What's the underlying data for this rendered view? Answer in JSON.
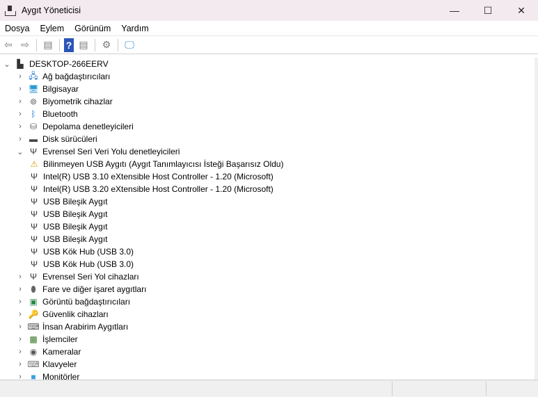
{
  "window": {
    "title": "Aygıt Yöneticisi",
    "minimize": "—",
    "maximize": "☐",
    "close": "✕"
  },
  "menu": [
    "Dosya",
    "Eylem",
    "Görünüm",
    "Yardım"
  ],
  "toolbar": [
    {
      "name": "back-icon",
      "glyph": "⇦"
    },
    {
      "name": "forward-icon",
      "glyph": "⇨"
    },
    {
      "name": "sep"
    },
    {
      "name": "show-hide-console-tree-icon",
      "glyph": "▤"
    },
    {
      "name": "sep"
    },
    {
      "name": "help-icon",
      "glyph": "?"
    },
    {
      "name": "action-pane-icon",
      "glyph": "▤"
    },
    {
      "name": "sep"
    },
    {
      "name": "update-driver-icon",
      "glyph": "⚙"
    },
    {
      "name": "sep"
    },
    {
      "name": "scan-hardware-icon",
      "glyph": "🖵"
    }
  ],
  "tree": {
    "root": "DESKTOP-266EERV",
    "items": [
      {
        "label": "Ağ bağdaştırıcıları",
        "icon": "network-icon",
        "glyph": "🖧",
        "color": "#2a7bd4",
        "level": 1,
        "expanded": false
      },
      {
        "label": "Bilgisayar",
        "icon": "computer-icon",
        "glyph": "🖥",
        "color": "#2a9ad4",
        "level": 1,
        "expanded": false
      },
      {
        "label": "Biyometrik cihazlar",
        "icon": "fingerprint-icon",
        "glyph": "⊚",
        "color": "#555",
        "level": 1,
        "expanded": false
      },
      {
        "label": "Bluetooth",
        "icon": "bluetooth-icon",
        "glyph": "ᛒ",
        "color": "#1a6fd8",
        "level": 1,
        "expanded": false
      },
      {
        "label": "Depolama denetleyicileri",
        "icon": "storage-controller-icon",
        "glyph": "⛁",
        "color": "#555",
        "level": 1,
        "expanded": false
      },
      {
        "label": "Disk sürücüleri",
        "icon": "disk-drive-icon",
        "glyph": "▬",
        "color": "#444",
        "level": 1,
        "expanded": false
      },
      {
        "label": "Evrensel Seri Veri Yolu denetleyicileri",
        "icon": "usb-icon",
        "glyph": "Ψ",
        "color": "#333",
        "level": 1,
        "expanded": true
      },
      {
        "label": "Bilinmeyen USB Aygıtı (Aygıt Tanımlayıcısı İsteği Başarısız Oldu)",
        "icon": "warning-icon",
        "glyph": "⚠",
        "color": "#d4a000",
        "level": 2
      },
      {
        "label": "Intel(R) USB 3.10 eXtensible Host Controller - 1.20 (Microsoft)",
        "icon": "usb-icon",
        "glyph": "Ψ",
        "color": "#333",
        "level": 2
      },
      {
        "label": "Intel(R) USB 3.20 eXtensible Host Controller - 1.20 (Microsoft)",
        "icon": "usb-icon",
        "glyph": "Ψ",
        "color": "#333",
        "level": 2
      },
      {
        "label": "USB Bileşik Aygıt",
        "icon": "usb-icon",
        "glyph": "Ψ",
        "color": "#333",
        "level": 2
      },
      {
        "label": "USB Bileşik Aygıt",
        "icon": "usb-icon",
        "glyph": "Ψ",
        "color": "#333",
        "level": 2
      },
      {
        "label": "USB Bileşik Aygıt",
        "icon": "usb-icon",
        "glyph": "Ψ",
        "color": "#333",
        "level": 2
      },
      {
        "label": "USB Bileşik Aygıt",
        "icon": "usb-icon",
        "glyph": "Ψ",
        "color": "#333",
        "level": 2
      },
      {
        "label": "USB Kök Hub (USB 3.0)",
        "icon": "usb-icon",
        "glyph": "Ψ",
        "color": "#333",
        "level": 2
      },
      {
        "label": "USB Kök Hub (USB 3.0)",
        "icon": "usb-icon",
        "glyph": "Ψ",
        "color": "#333",
        "level": 2
      },
      {
        "label": "Evrensel Seri Yol cihazları",
        "icon": "usb-icon",
        "glyph": "Ψ",
        "color": "#333",
        "level": 1,
        "expanded": false
      },
      {
        "label": "Fare ve diğer işaret aygıtları",
        "icon": "mouse-icon",
        "glyph": "⬮",
        "color": "#666",
        "level": 1,
        "expanded": false
      },
      {
        "label": "Görüntü bağdaştırıcıları",
        "icon": "display-adapter-icon",
        "glyph": "▣",
        "color": "#2a8a4a",
        "level": 1,
        "expanded": false
      },
      {
        "label": "Güvenlik cihazları",
        "icon": "security-device-icon",
        "glyph": "🔑",
        "color": "#c9a000",
        "level": 1,
        "expanded": false
      },
      {
        "label": "İnsan Arabirim Aygıtları",
        "icon": "hid-icon",
        "glyph": "⌨",
        "color": "#555",
        "level": 1,
        "expanded": false
      },
      {
        "label": "İşlemciler",
        "icon": "processor-icon",
        "glyph": "▩",
        "color": "#3a7a2a",
        "level": 1,
        "expanded": false
      },
      {
        "label": "Kameralar",
        "icon": "camera-icon",
        "glyph": "◉",
        "color": "#555",
        "level": 1,
        "expanded": false
      },
      {
        "label": "Klavyeler",
        "icon": "keyboard-icon",
        "glyph": "⌨",
        "color": "#777",
        "level": 1,
        "expanded": false
      },
      {
        "label": "Monitörler",
        "icon": "monitor-icon",
        "glyph": "■",
        "color": "#3aa0e0",
        "level": 1,
        "expanded": false
      }
    ]
  }
}
